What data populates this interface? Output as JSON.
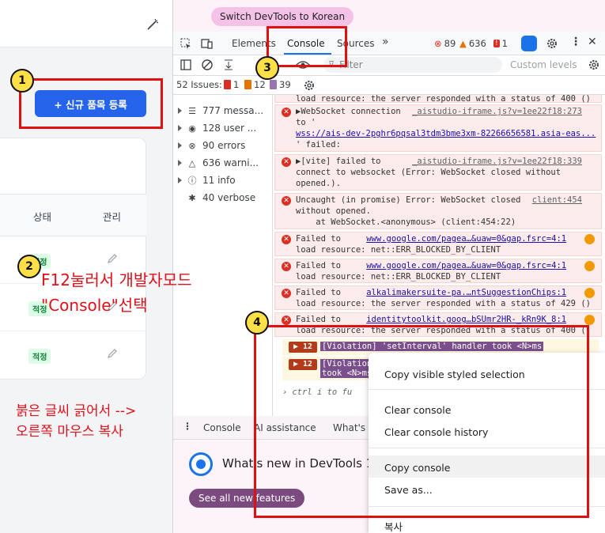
{
  "left_app": {
    "add_button": "+  신규 품목 등록",
    "table": {
      "headers": [
        "상태",
        "관리"
      ],
      "rows": [
        {
          "status": "적정"
        },
        {
          "status": "적정"
        },
        {
          "status": "적정"
        }
      ]
    }
  },
  "devtools": {
    "switch_button": "Switch DevTools to Korean",
    "tabs": [
      "Elements",
      "Console",
      "Sources"
    ],
    "active_tab": "Console",
    "counts": {
      "errors": "89",
      "warnings": "636",
      "issues": "1"
    },
    "toolbar": {
      "filter_placeholder": "Filter",
      "levels": "Custom levels ▾"
    },
    "issues_bar": {
      "label": "52 Issues:",
      "errors": "1",
      "warnings": "12",
      "info": "39"
    },
    "sidebar": [
      {
        "label": "777 messa...",
        "icon": "list-icon"
      },
      {
        "label": "128 user ...",
        "icon": "user-icon"
      },
      {
        "label": "90 errors",
        "icon": "error-icon"
      },
      {
        "label": "636 warni...",
        "icon": "warning-icon"
      },
      {
        "label": "11 info",
        "icon": "info-icon"
      },
      {
        "label": "40 verbose",
        "icon": "bug-icon"
      }
    ],
    "messages": [
      {
        "line1": "load resource: the server responded with a status of 400 ()"
      },
      {
        "line1": "▶WebSocket connection",
        "src": "_aistudio-iframe.js?v=1ee22f18:273",
        "line2": "to '",
        "link": "wss://ais-dev-2pghr6pqsal3tdm3bme3xm-82266656581.asia-eas...",
        "line3": "' failed:"
      },
      {
        "line1": "▶[vite] failed to",
        "src": "_aistudio-iframe.js?v=1ee22f18:339",
        "line2": "connect to websocket (Error: WebSocket closed without",
        "line3": "opened.)."
      },
      {
        "line1": "Uncaught (in promise) Error: WebSocket closed",
        "src": "client:454",
        "line2": "without opened.",
        "line3": "    at WebSocket.<anonymous> (client:454:22)"
      },
      {
        "line1": "Failed to",
        "link": "www.google.com/pagea…&uaw=0&gap.fsrc=4:1",
        "line2": "load resource: net::ERR_BLOCKED_BY_CLIENT"
      },
      {
        "line1": "Failed to",
        "link": "www.google.com/pagea…&uaw=0&gap.fsrc=4:1",
        "line2": "load resource: net::ERR_BLOCKED_BY_CLIENT"
      },
      {
        "line1": "Failed to",
        "link": "alkalimakersuite-pa.…ntSuggestionChips:1",
        "line2": "load resource: the server responded with a status of 429 ()"
      },
      {
        "line1": "Failed to",
        "link": "identitytoolkit.goog…bSUmr2HR-_kRn9K_8:1",
        "line2": "load resource: the server responded with a status of 400 ()"
      }
    ],
    "violations": [
      {
        "count": "12",
        "text": "[Violation] 'setInterval' handler took <N>ms"
      },
      {
        "count": "12",
        "text": "[Violation]",
        "text2": "took <N>ms"
      }
    ],
    "prompt_hint": "ctrl  i  to fu",
    "drawer": {
      "tabs": [
        "Console",
        "AI assistance",
        "What's n"
      ],
      "whats_new": "What's new in DevTools 1",
      "see_all": "See all new features"
    }
  },
  "context_menu": {
    "items": [
      "Copy visible styled selection",
      "Clear console",
      "Clear console history",
      "Copy console",
      "Save as...",
      "복사"
    ]
  },
  "annotations": {
    "numbers": [
      "1",
      "2",
      "3",
      "4"
    ],
    "text_f12_line1": "F12눌러서 개발자모드",
    "text_f12_line2": "\"Console\"선택",
    "text_copy_line1": "붉은 글씨 긁어서 -->",
    "text_copy_line2": "오른쪽 마우스 복사"
  },
  "colors": {
    "annotation_red": "#e01010",
    "annotation_yellow": "#fde047",
    "primary_blue": "#2563eb"
  }
}
